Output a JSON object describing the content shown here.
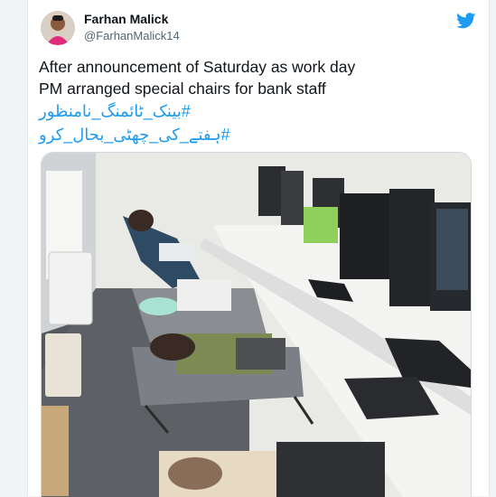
{
  "author": {
    "name": "Farhan Malick",
    "handle": "@FarhanMalick14"
  },
  "tweet": {
    "line1": "After announcement of Saturday as work day",
    "line2": "PM arranged special chairs for bank staff",
    "hashtag1": "#بینک_ٹائمنگ_نامنظور",
    "hashtag2": "#ہفتے_کی_چھٹی_بحال_کرو"
  },
  "icons": {
    "avatar": "avatar-photo",
    "brand": "twitter-bird-icon"
  },
  "colors": {
    "link": "#1d9bf0",
    "text": "#0f1419",
    "secondary": "#536471"
  }
}
